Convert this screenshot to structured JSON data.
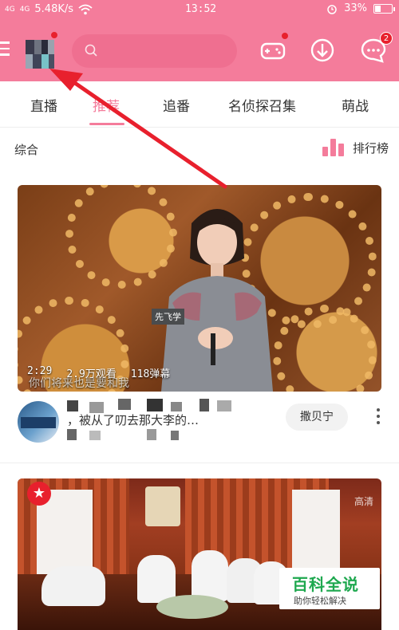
{
  "status_bar": {
    "signal_1": "4G",
    "signal_2": "4G",
    "speed": "5.48K/s",
    "time": "13:52",
    "battery": "33%",
    "battery_level": 0.33
  },
  "header": {
    "message_badge": "2"
  },
  "tabs": [
    {
      "label": "直播",
      "active": false
    },
    {
      "label": "推荐",
      "active": true
    },
    {
      "label": "追番",
      "active": false
    },
    {
      "label": "名侦探召集",
      "active": false
    },
    {
      "label": "萌战",
      "active": false
    }
  ],
  "section": {
    "title": "综合",
    "rank_label": "排行榜"
  },
  "video1": {
    "duration": "2:29",
    "views": "2.9万观看",
    "danmaku": "118弹幕",
    "subtitle": "你们将来也是要和我",
    "name_caption": "先飞学",
    "title": "，被从了叨去那大李的…",
    "follow": "撒贝宁"
  },
  "video2": {
    "tag": "高清"
  },
  "watermark": {
    "title": "百科全说",
    "subtitle": "助你轻松解决"
  },
  "colors": {
    "brand": "#f47c9b",
    "badge": "#e8202d",
    "arrow": "#e8202d"
  }
}
